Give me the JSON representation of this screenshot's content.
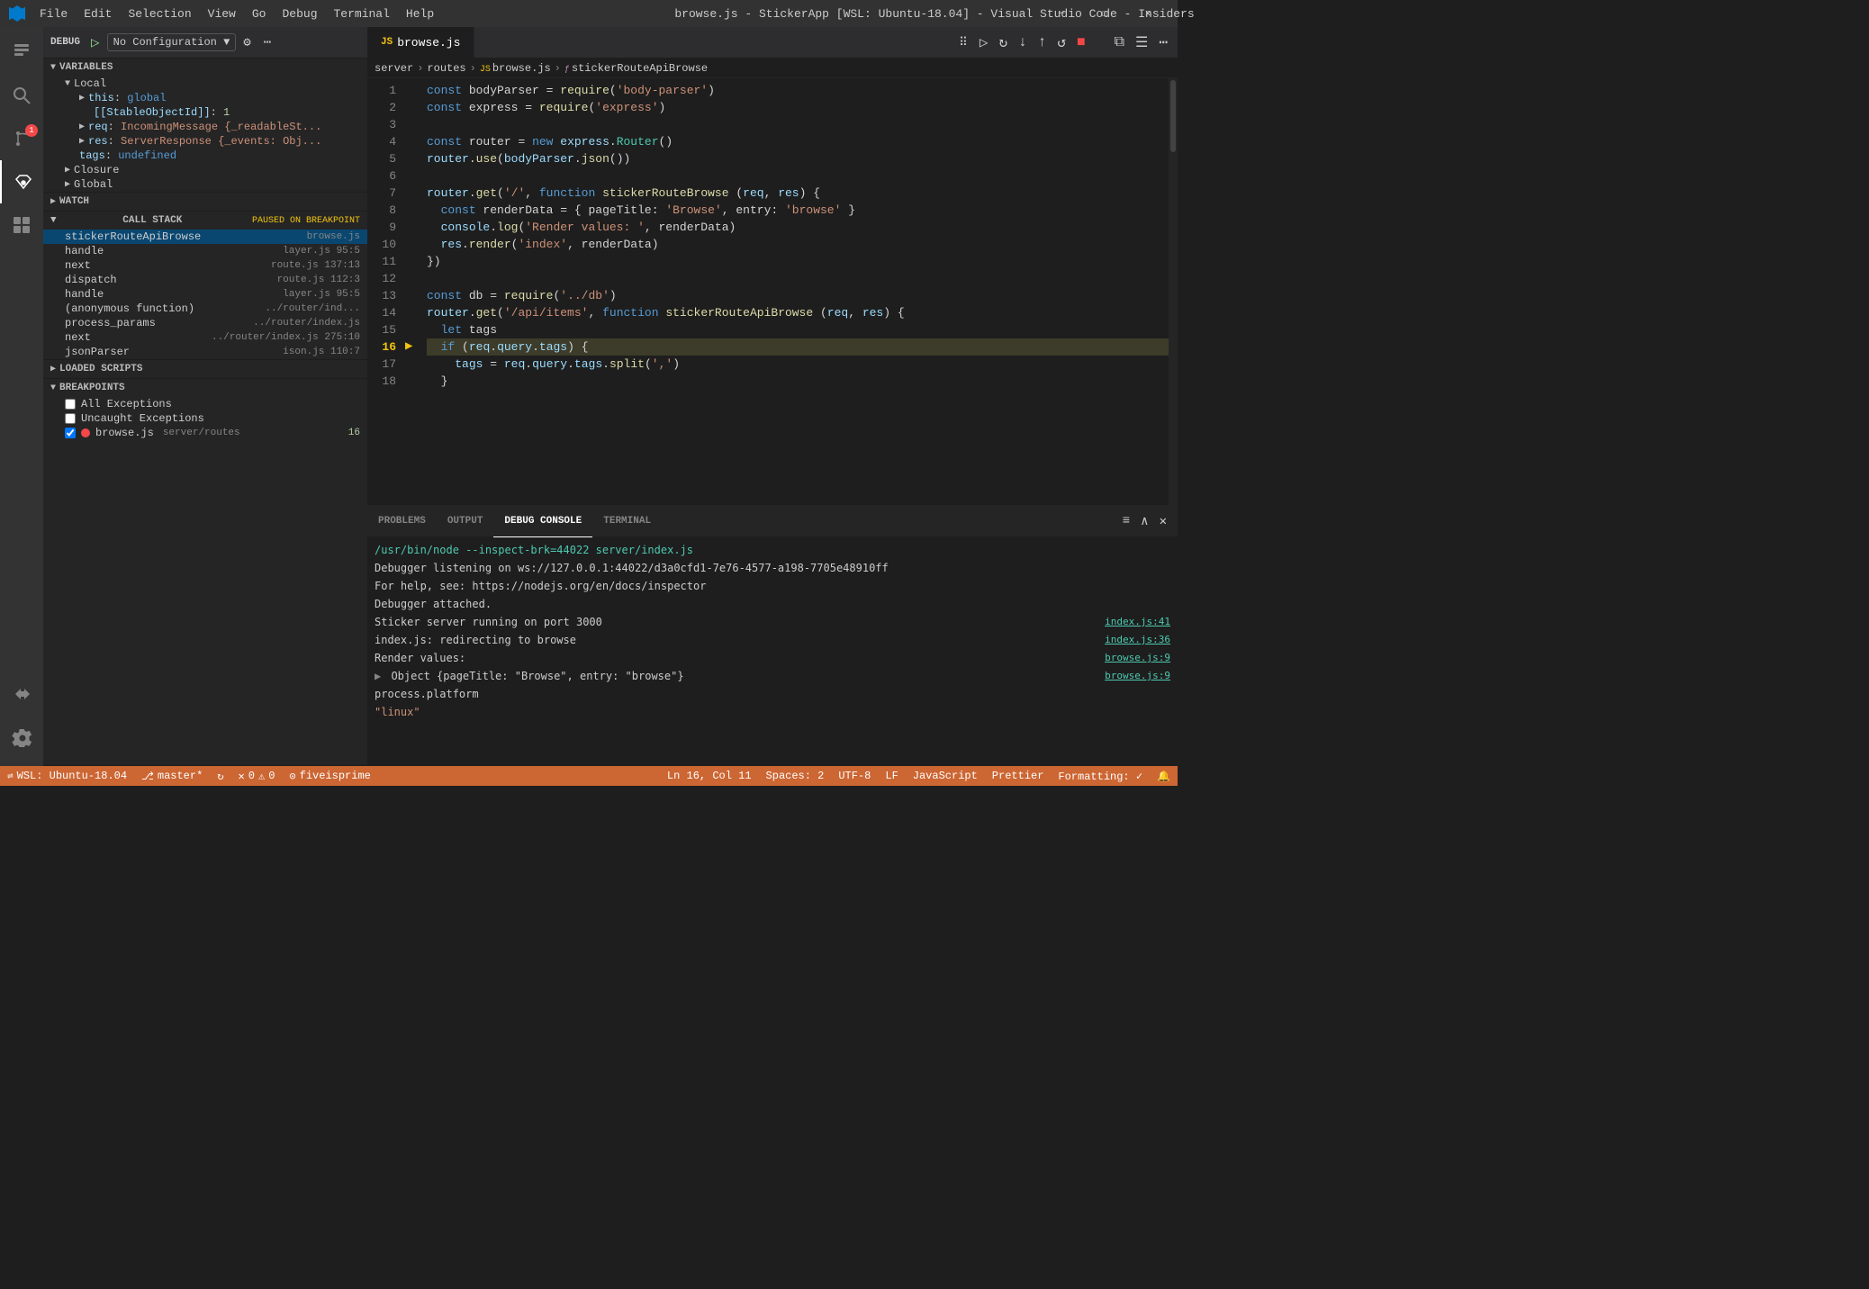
{
  "window": {
    "title": "browse.js - StickerApp [WSL: Ubuntu-18.04] - Visual Studio Code - Insiders",
    "min_label": "—",
    "max_label": "☐",
    "close_label": "✕"
  },
  "menu": {
    "items": [
      "File",
      "Edit",
      "Selection",
      "View",
      "Go",
      "Debug",
      "Terminal",
      "Help"
    ]
  },
  "debug_bar": {
    "label": "DEBUG",
    "config": "No Configuration",
    "config_arrow": "▼"
  },
  "editor_tabs": [
    {
      "name": "browse.js",
      "lang": "JS"
    }
  ],
  "breadcrumb": {
    "items": [
      "server",
      "routes",
      "browse.js",
      "stickerRouteApiBrowse"
    ],
    "types": [
      "folder",
      "folder",
      "js",
      "function"
    ]
  },
  "code": {
    "lines": [
      {
        "num": 1,
        "text": "const bodyParser = require('body-parser')"
      },
      {
        "num": 2,
        "text": "const express = require('express')"
      },
      {
        "num": 3,
        "text": ""
      },
      {
        "num": 4,
        "text": "const router = new express.Router()"
      },
      {
        "num": 5,
        "text": "router.use(bodyParser.json())"
      },
      {
        "num": 6,
        "text": ""
      },
      {
        "num": 7,
        "text": "router.get('/', function stickerRouteBrowse (req, res) {"
      },
      {
        "num": 8,
        "text": "  const renderData = { pageTitle: 'Browse', entry: 'browse' }"
      },
      {
        "num": 9,
        "text": "  console.log('Render values: ', renderData)"
      },
      {
        "num": 10,
        "text": "  res.render('index', renderData)"
      },
      {
        "num": 11,
        "text": "})"
      },
      {
        "num": 12,
        "text": ""
      },
      {
        "num": 13,
        "text": "const db = require('../db')"
      },
      {
        "num": 14,
        "text": "router.get('/api/items', function stickerRouteApiBrowse (req, res) {"
      },
      {
        "num": 15,
        "text": "  let tags"
      },
      {
        "num": 16,
        "text": "  if (req.query.tags) {",
        "highlighted": true,
        "has_arrow": true
      },
      {
        "num": 17,
        "text": "    tags = req.query.tags.split(',')"
      },
      {
        "num": 18,
        "text": "  }"
      }
    ]
  },
  "sidebar": {
    "variables": {
      "title": "VARIABLES",
      "sections": [
        {
          "name": "Local",
          "items": [
            {
              "key": "this",
              "val": "global",
              "type": "plain"
            },
            {
              "key": "[[StableObjectId]]",
              "val": "1",
              "type": "num",
              "indent": 2
            },
            {
              "key": "req",
              "val": "IncomingMessage {_readableSt...",
              "type": "plain"
            },
            {
              "key": "res",
              "val": "ServerResponse {_events: Obj...",
              "type": "plain"
            },
            {
              "key": "tags",
              "val": "undefined",
              "type": "undef"
            }
          ]
        },
        {
          "name": "Closure"
        },
        {
          "name": "Global"
        }
      ]
    },
    "watch": {
      "title": "WATCH"
    },
    "call_stack": {
      "title": "CALL STACK",
      "status": "PAUSED ON BREAKPOINT",
      "items": [
        {
          "fn": "stickerRouteApiBrowse",
          "file": "browse.js",
          "line": ""
        },
        {
          "fn": "handle",
          "file": "layer.js",
          "line": "95:5"
        },
        {
          "fn": "next",
          "file": "route.js",
          "line": "137:13"
        },
        {
          "fn": "dispatch",
          "file": "route.js",
          "line": "112:3"
        },
        {
          "fn": "handle",
          "file": "layer.js",
          "line": "95:5"
        },
        {
          "fn": "(anonymous function)",
          "file": "../router/ind...",
          "line": ""
        },
        {
          "fn": "process_params",
          "file": "../router/index.js",
          "line": ""
        },
        {
          "fn": "next",
          "file": "../router/index.js",
          "line": "275:10"
        },
        {
          "fn": "jsonParser",
          "file": "ison.js",
          "line": "110:7"
        }
      ]
    },
    "loaded_scripts": {
      "title": "LOADED SCRIPTS"
    },
    "breakpoints": {
      "title": "BREAKPOINTS",
      "items": [
        {
          "label": "All Exceptions",
          "checked": false
        },
        {
          "label": "Uncaught Exceptions",
          "checked": false
        },
        {
          "label": "browse.js",
          "path": "server/routes",
          "line": "16",
          "checked": true,
          "has_dot": true
        }
      ]
    }
  },
  "panel": {
    "tabs": [
      "PROBLEMS",
      "OUTPUT",
      "DEBUG CONSOLE",
      "TERMINAL"
    ],
    "active_tab": "DEBUG CONSOLE",
    "console_lines": [
      {
        "text": "/usr/bin/node --inspect-brk=44022 server/index.js",
        "type": "command"
      },
      {
        "text": "Debugger listening on ws://127.0.0.1:44022/d3a0cfd1-7e76-4577-a198-7705e48910ff",
        "type": "normal"
      },
      {
        "text": "For help, see: https://nodejs.org/en/docs/inspector",
        "type": "normal"
      },
      {
        "text": "Debugger attached.",
        "type": "normal"
      },
      {
        "text": "Sticker server running on port 3000",
        "link": "index.js:41",
        "type": "link"
      },
      {
        "text": "index.js: redirecting to browse",
        "link": "index.js:36",
        "type": "link"
      },
      {
        "text": "Render values: ",
        "link": "browse.js:9",
        "type": "link"
      },
      {
        "text": "> Object {pageTitle: \"Browse\", entry: \"browse\"}",
        "link": "browse.js:9",
        "type": "link"
      },
      {
        "text": "process.platform",
        "type": "normal"
      },
      {
        "text": "\"linux\"",
        "type": "string"
      }
    ]
  },
  "status_bar": {
    "left_items": [
      {
        "icon": "wsl",
        "text": "WSL: Ubuntu-18.04"
      },
      {
        "icon": "branch",
        "text": "master*"
      },
      {
        "icon": "refresh",
        "text": ""
      },
      {
        "icon": "error",
        "text": "0"
      },
      {
        "icon": "warning",
        "text": "0"
      },
      {
        "icon": "github",
        "text": "fiveisprime"
      }
    ],
    "right_items": [
      {
        "text": "Ln 16, Col 11"
      },
      {
        "text": "Spaces: 2"
      },
      {
        "text": "UTF-8"
      },
      {
        "text": "LF"
      },
      {
        "text": "JavaScript"
      },
      {
        "text": "Prettier"
      },
      {
        "text": "Formatting: ✓"
      },
      {
        "icon": "bell",
        "text": ""
      }
    ]
  },
  "icons": {
    "explorer": "⬡",
    "search": "🔍",
    "git": "⎇",
    "debug": "🐛",
    "extensions": "⊞",
    "remote": "><",
    "settings": "⚙"
  }
}
